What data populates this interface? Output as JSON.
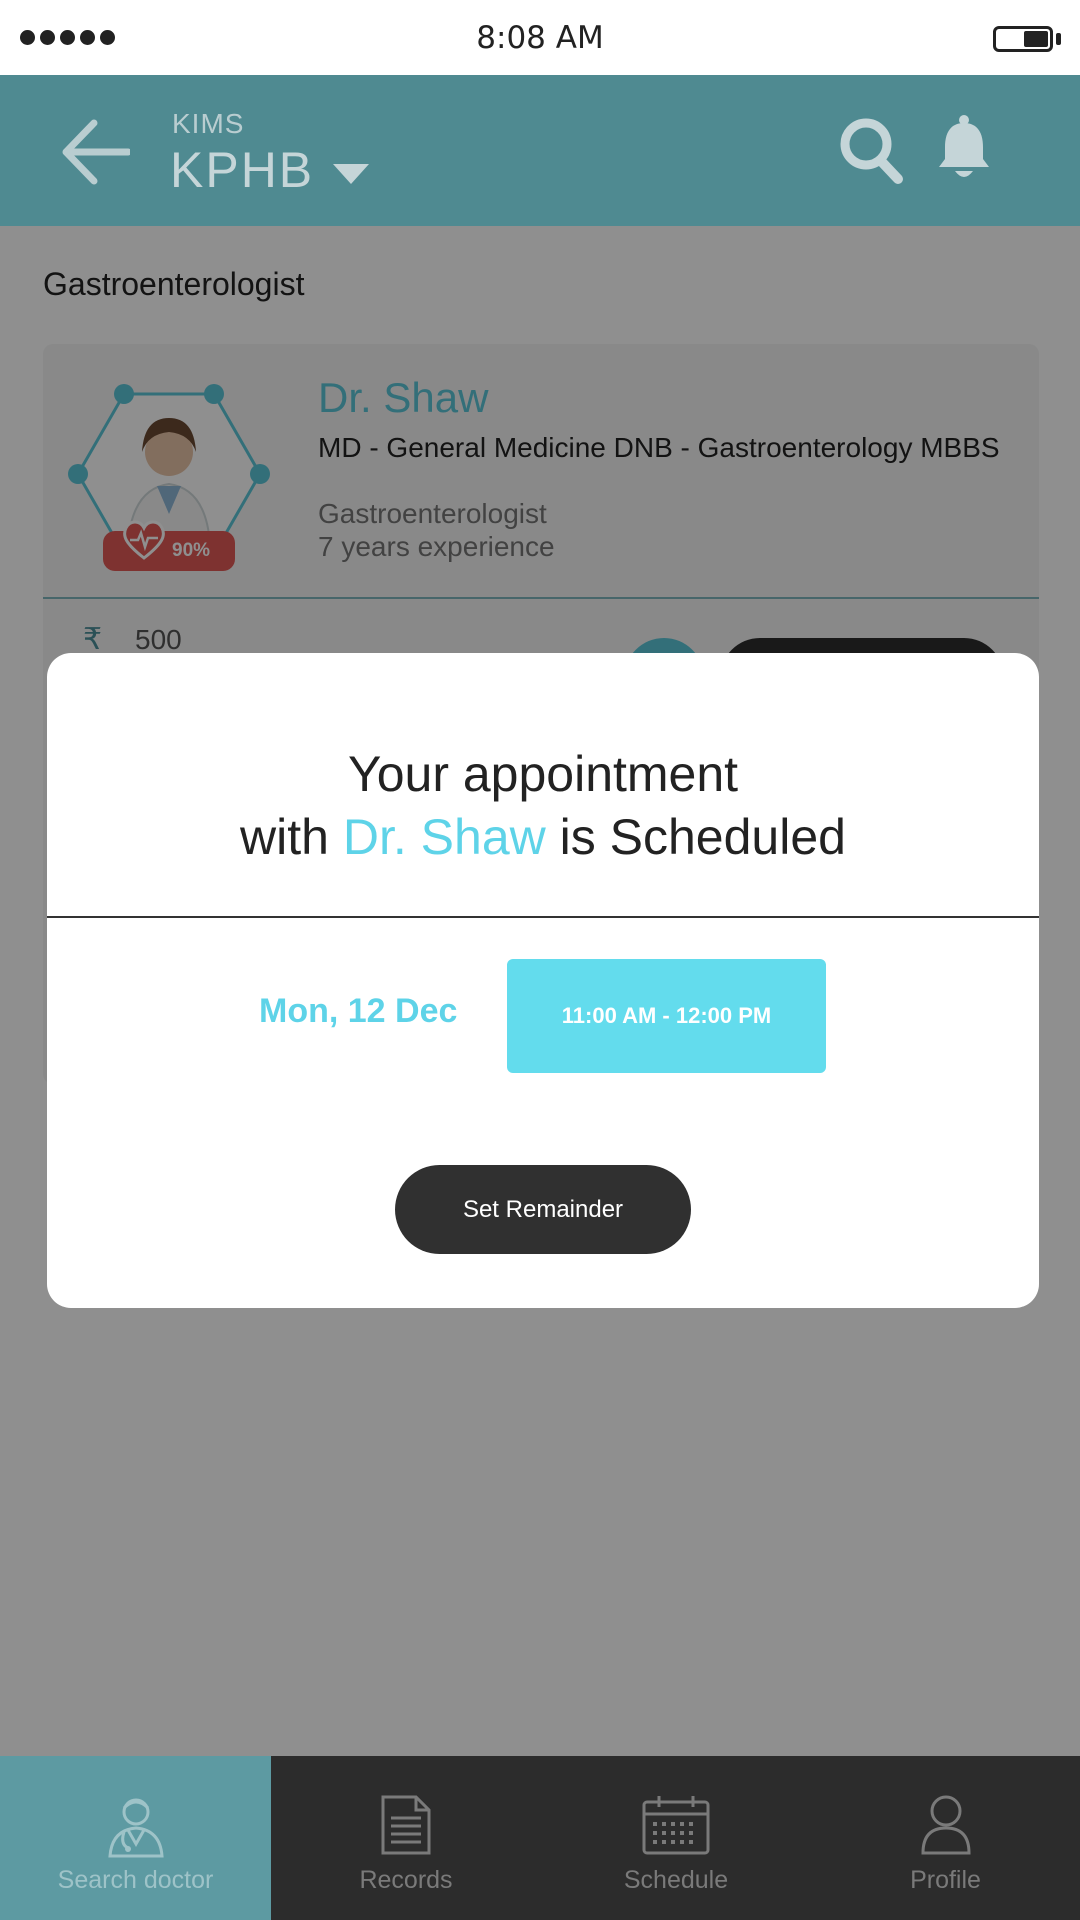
{
  "status_bar": {
    "time": "8:08 AM"
  },
  "header": {
    "hospital": "KIMS",
    "location": "KPHB"
  },
  "page": {
    "specialty": "Gastroenterologist"
  },
  "doctor_card": {
    "name": "Dr. Shaw",
    "qualifications": "MD - General Medicine DNB - Gastroenterology MBBS",
    "specialty": "Gastroenterologist",
    "experience": "7 years experience",
    "rating": "90%",
    "fee_symbol": "₹",
    "fee": "500"
  },
  "modal": {
    "title_line1": "Your appointment",
    "title_with": "with",
    "doctor_name": "Dr. Shaw",
    "title_suffix": "is Scheduled",
    "date": "Mon, 12 Dec",
    "time_slot": "11:00 AM - 12:00 PM",
    "reminder_button": "Set Remainder"
  },
  "nav": {
    "items": [
      {
        "label": "Search doctor",
        "icon": "doctor-icon",
        "active": true
      },
      {
        "label": "Records",
        "icon": "document-icon",
        "active": false
      },
      {
        "label": "Schedule",
        "icon": "calendar-icon",
        "active": false
      },
      {
        "label": "Profile",
        "icon": "user-icon",
        "active": false
      }
    ]
  },
  "colors": {
    "header": "#4f8a91",
    "accent": "#5ed3e8",
    "slot": "#63dced",
    "dark_button": "#303030",
    "nav_bg": "#2c2c2c",
    "nav_active": "#5d9aa2",
    "badge": "#e05a57"
  }
}
